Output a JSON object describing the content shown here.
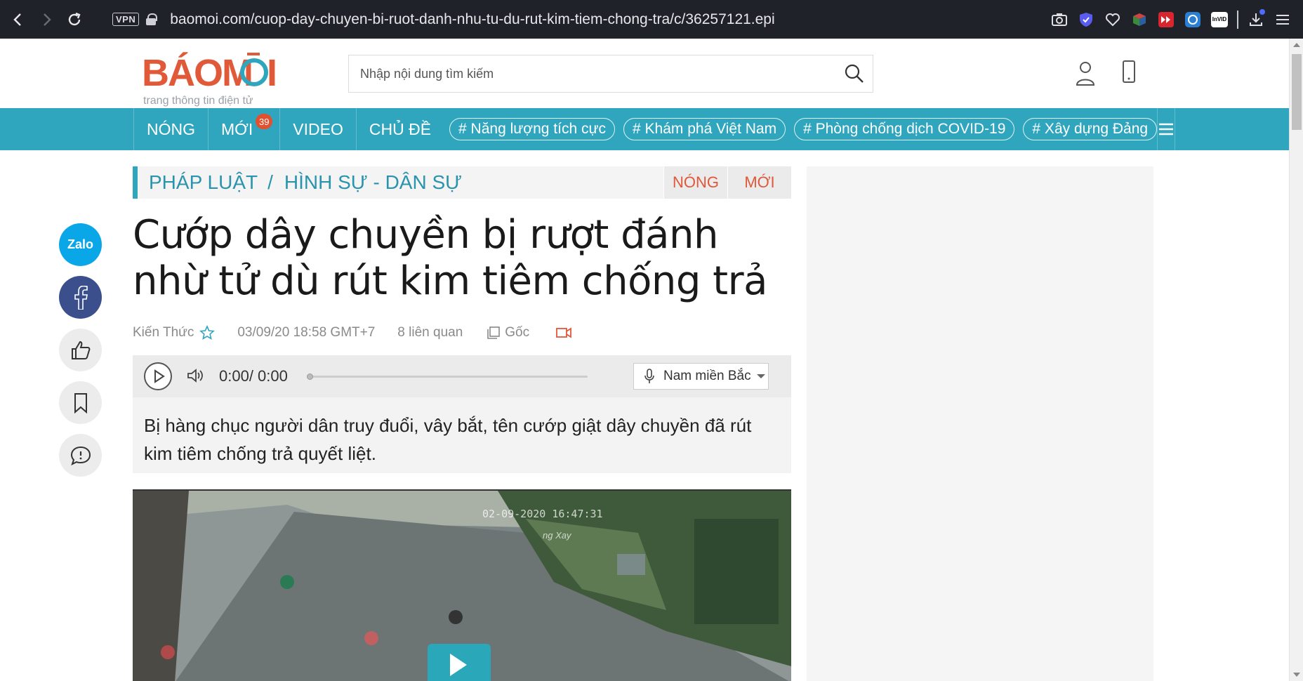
{
  "browser": {
    "vpn_label": "VPN",
    "url": "baomoi.com/cuop-day-chuyen-bi-ruot-danh-nhu-tu-du-rut-kim-tiem-chong-tra/c/36257121.epi",
    "invid_label": "InVID"
  },
  "header": {
    "logo_text": "BÁOMỚI",
    "tagline": "trang thông tin điện tử",
    "search_placeholder": "Nhập nội dung tìm kiếm"
  },
  "nav": {
    "items": [
      {
        "label": "NÓNG"
      },
      {
        "label": "MỚI",
        "badge": "39"
      },
      {
        "label": "VIDEO"
      },
      {
        "label": "CHỦ ĐỀ"
      }
    ],
    "tags": [
      "# Năng lượng tích cực",
      "# Khám phá Việt Nam",
      "# Phòng chống dịch COVID-19",
      "# Xây dựng Đảng"
    ]
  },
  "breadcrumb": {
    "category": "PHÁP LUẬT",
    "separator": "/",
    "subcategory": "HÌNH SỰ - DÂN SỰ",
    "filter_hot": "NÓNG",
    "filter_new": "MỚI"
  },
  "share": {
    "zalo_label": "Zalo"
  },
  "article": {
    "title": "Cướp dây chuyền bị rượt đánh nhừ tử dù rút kim tiêm chống trả",
    "source": "Kiến Thức",
    "datetime": "03/09/20 18:58 GMT+7",
    "related": "8 liên quan",
    "original": "Gốc",
    "sapo": "Bị hàng chục người dân truy đuổi, vây bắt, tên cướp giật dây chuyền đã rút kim tiêm chống trả quyết liệt."
  },
  "audio": {
    "time": "0:00/ 0:00",
    "progress": 0,
    "voice": "Nam miền Bắc"
  },
  "video": {
    "timestamp": "02-09-2020 16:47:31",
    "sign_text": "ng Xay"
  },
  "colors": {
    "brand_teal": "#2fa6bd",
    "brand_orange": "#e05a3a",
    "facebook": "#3b4f8c",
    "zalo": "#0aa7e8"
  }
}
